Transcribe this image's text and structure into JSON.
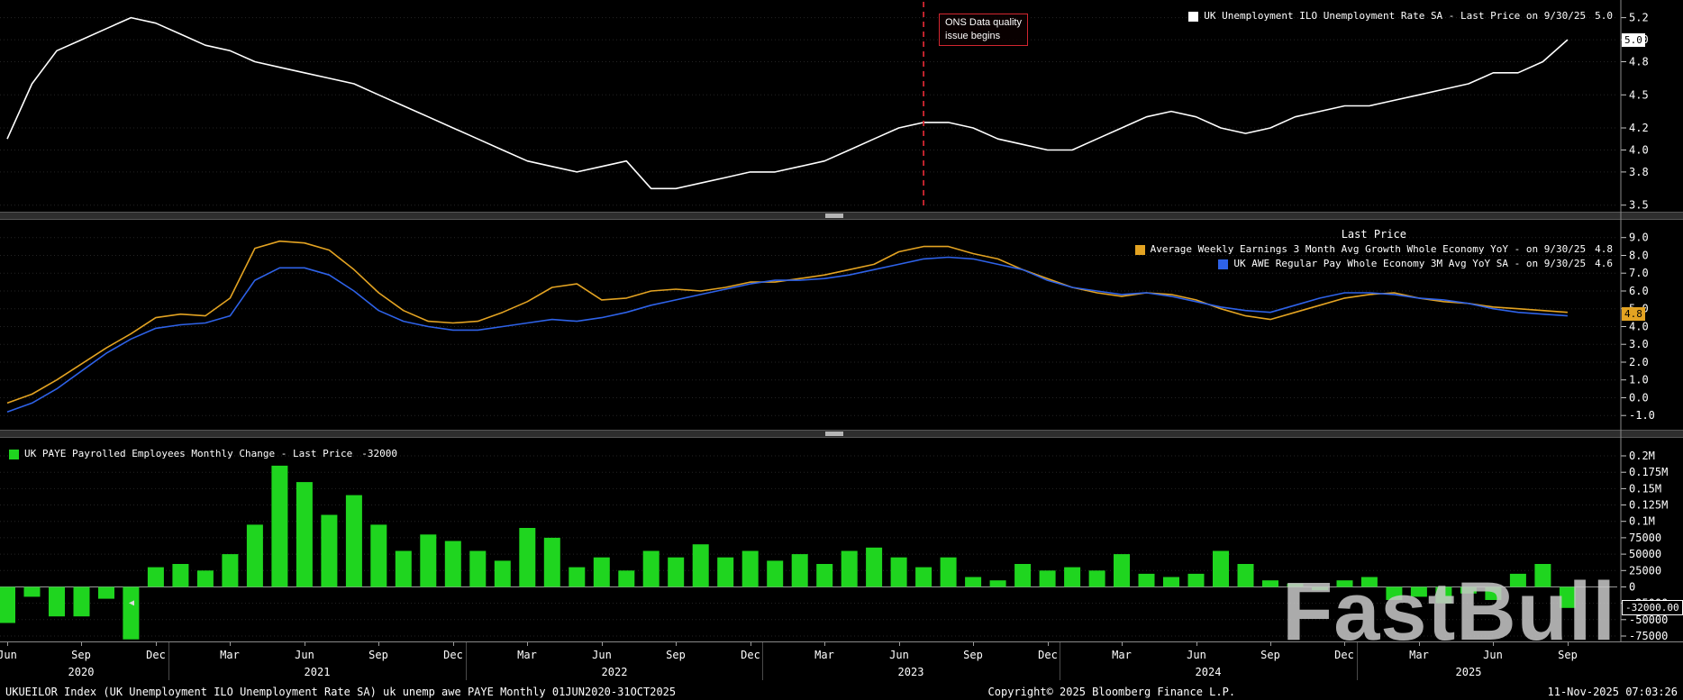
{
  "watermark": "FastBull",
  "ui": {
    "left_marker": "◀"
  },
  "status_bar": {
    "left": "UKUEILOR Index (UK Unemployment ILO Unemployment Rate SA) uk unemp awe PAYE Monthly 01JUN2020-31OCT2025",
    "center": "Copyright© 2025 Bloomberg Finance L.P.",
    "right": "11-Nov-2025 07:03:26"
  },
  "x_axis": {
    "quarter_ticks": [
      {
        "label": "Jun",
        "index": 0
      },
      {
        "label": "Sep",
        "index": 3
      },
      {
        "label": "Dec",
        "index": 6
      },
      {
        "label": "Mar",
        "index": 9
      },
      {
        "label": "Jun",
        "index": 12
      },
      {
        "label": "Sep",
        "index": 15
      },
      {
        "label": "Dec",
        "index": 18
      },
      {
        "label": "Mar",
        "index": 21
      },
      {
        "label": "Jun",
        "index": 24
      },
      {
        "label": "Sep",
        "index": 27
      },
      {
        "label": "Dec",
        "index": 30
      },
      {
        "label": "Mar",
        "index": 33
      },
      {
        "label": "Jun",
        "index": 36
      },
      {
        "label": "Sep",
        "index": 39
      },
      {
        "label": "Dec",
        "index": 42
      },
      {
        "label": "Mar",
        "index": 45
      },
      {
        "label": "Jun",
        "index": 48
      },
      {
        "label": "Sep",
        "index": 51
      },
      {
        "label": "Dec",
        "index": 54
      },
      {
        "label": "Mar",
        "index": 57
      },
      {
        "label": "Jun",
        "index": 60
      },
      {
        "label": "Sep",
        "index": 63
      }
    ],
    "year_labels": [
      {
        "label": "2020",
        "center_index": 3
      },
      {
        "label": "2021",
        "center_index": 12.5
      },
      {
        "label": "2022",
        "center_index": 24.5
      },
      {
        "label": "2023",
        "center_index": 36.5
      },
      {
        "label": "2024",
        "center_index": 48.5
      },
      {
        "label": "2025",
        "center_index": 59
      }
    ],
    "year_boundaries": [
      6.5,
      18.5,
      30.5,
      42.5,
      54.5
    ]
  },
  "chart_data": [
    {
      "type": "line",
      "panel": "top",
      "x_start": "Jun 2020",
      "x_frequency": "monthly",
      "legend": {
        "label": "UK Unemployment ILO Unemployment Rate SA - Last Price on 9/30/25",
        "value": "5.0"
      },
      "y_ticks": [
        5.2,
        5.0,
        4.8,
        4.5,
        4.2,
        4.0,
        3.8,
        3.5
      ],
      "y_tick_labels": [
        "5.2",
        "5.0",
        "4.8",
        "4.5",
        "4.2",
        "4.0",
        "3.8",
        "3.5"
      ],
      "y_range": [
        3.44,
        5.36
      ],
      "grid": true,
      "last_price_box": "5.0",
      "annotation": {
        "text": "ONS Data quality\nissue begins",
        "month_index": 37,
        "color": "#d22630"
      },
      "series": [
        {
          "name": "UK Unemployment ILO Unemployment Rate SA",
          "color": "#ffffff",
          "values": [
            4.1,
            4.6,
            4.9,
            5.0,
            5.1,
            5.2,
            5.15,
            5.05,
            4.95,
            4.9,
            4.8,
            4.75,
            4.7,
            4.65,
            4.6,
            4.5,
            4.4,
            4.3,
            4.2,
            4.1,
            4.0,
            3.9,
            3.85,
            3.8,
            3.85,
            3.9,
            3.65,
            3.65,
            3.7,
            3.75,
            3.8,
            3.8,
            3.85,
            3.9,
            4.0,
            4.1,
            4.2,
            4.25,
            4.25,
            4.2,
            4.1,
            4.05,
            4.0,
            4.0,
            4.1,
            4.2,
            4.3,
            4.35,
            4.3,
            4.2,
            4.15,
            4.2,
            4.3,
            4.35,
            4.4,
            4.4,
            4.45,
            4.5,
            4.55,
            4.6,
            4.7,
            4.7,
            4.8,
            5.0
          ]
        }
      ]
    },
    {
      "type": "line",
      "panel": "middle",
      "legend_title": "Last Price",
      "y_ticks": [
        9.0,
        8.0,
        7.0,
        6.0,
        5.0,
        4.0,
        3.0,
        2.0,
        1.0,
        0.0,
        -1.0
      ],
      "y_tick_labels": [
        "9.0",
        "8.0",
        "7.0",
        "6.0",
        "5.0",
        "4.0",
        "3.0",
        "2.0",
        "1.0",
        "0.0",
        "-1.0"
      ],
      "y_range": [
        -1.8,
        10.0
      ],
      "grid": true,
      "last_price_box": "4.8",
      "series": [
        {
          "name": "Average Weekly Earnings 3 Month Avg Growth Whole Economy YoY",
          "legend_label": "Average Weekly Earnings 3 Month Avg Growth Whole Economy YoY -  on 9/30/25",
          "value": "4.8",
          "color": "#e3a322",
          "values": [
            -0.3,
            0.2,
            1.0,
            1.9,
            2.8,
            3.6,
            4.5,
            4.7,
            4.6,
            5.6,
            8.4,
            8.8,
            8.7,
            8.3,
            7.2,
            5.9,
            4.9,
            4.3,
            4.2,
            4.3,
            4.8,
            5.4,
            6.2,
            6.4,
            5.5,
            5.6,
            6.0,
            6.1,
            6.0,
            6.2,
            6.5,
            6.5,
            6.7,
            6.9,
            7.2,
            7.5,
            8.2,
            8.5,
            8.5,
            8.1,
            7.8,
            7.2,
            6.7,
            6.2,
            5.9,
            5.7,
            5.9,
            5.8,
            5.5,
            5.0,
            4.6,
            4.4,
            4.8,
            5.2,
            5.6,
            5.8,
            5.9,
            5.6,
            5.4,
            5.3,
            5.1,
            5.0,
            4.9,
            4.8
          ]
        },
        {
          "name": "UK AWE Regular Pay Whole Economy 3M Avg YoY SA",
          "legend_label": "UK AWE Regular Pay Whole Economy 3M Avg YoY SA -  on 9/30/25",
          "value": "4.6",
          "color": "#2e62e8",
          "values": [
            -0.8,
            -0.3,
            0.5,
            1.5,
            2.5,
            3.3,
            3.9,
            4.1,
            4.2,
            4.6,
            6.6,
            7.3,
            7.3,
            6.9,
            6.0,
            4.9,
            4.3,
            4.0,
            3.8,
            3.8,
            4.0,
            4.2,
            4.4,
            4.3,
            4.5,
            4.8,
            5.2,
            5.5,
            5.8,
            6.1,
            6.4,
            6.6,
            6.6,
            6.7,
            6.9,
            7.2,
            7.5,
            7.8,
            7.9,
            7.8,
            7.5,
            7.2,
            6.6,
            6.2,
            6.0,
            5.8,
            5.9,
            5.7,
            5.4,
            5.1,
            4.9,
            4.8,
            5.2,
            5.6,
            5.9,
            5.9,
            5.8,
            5.6,
            5.5,
            5.3,
            5.0,
            4.8,
            4.7,
            4.6
          ]
        }
      ]
    },
    {
      "type": "bar",
      "panel": "bottom",
      "legend": {
        "label": "UK PAYE Payrolled Employees Monthly Change - Last Price",
        "value": "-32000"
      },
      "color": "#1fd51f",
      "y_ticks": [
        200000,
        175000,
        150000,
        125000,
        100000,
        75000,
        50000,
        25000,
        0,
        -25000,
        -50000,
        -75000
      ],
      "y_tick_labels": [
        "0.2M",
        "0.175M",
        "0.15M",
        "0.125M",
        "0.1M",
        "75000",
        "50000",
        "25000",
        "0",
        "-25000",
        "-50000",
        "-75000"
      ],
      "y_range": [
        -83250,
        227500
      ],
      "grid": true,
      "last_price_box": "-32000.00",
      "values": [
        -55000,
        -15000,
        -45000,
        -45000,
        -18000,
        -80000,
        30000,
        35000,
        25000,
        50000,
        95000,
        185000,
        160000,
        110000,
        140000,
        95000,
        55000,
        80000,
        70000,
        55000,
        40000,
        90000,
        75000,
        30000,
        45000,
        25000,
        55000,
        45000,
        65000,
        45000,
        55000,
        40000,
        50000,
        35000,
        55000,
        60000,
        45000,
        30000,
        45000,
        15000,
        10000,
        35000,
        25000,
        30000,
        25000,
        50000,
        20000,
        15000,
        20000,
        55000,
        35000,
        10000,
        5000,
        -5000,
        10000,
        15000,
        -20000,
        -15000,
        -25000,
        -10000,
        -20000,
        20000,
        35000,
        -32000
      ]
    }
  ]
}
